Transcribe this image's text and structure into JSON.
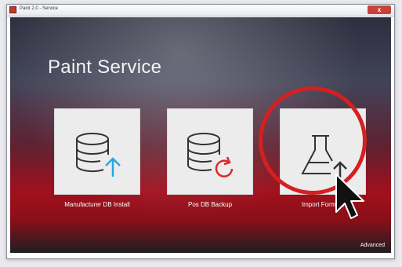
{
  "window": {
    "title": "Paint 2.0 - Service",
    "close_label": "x"
  },
  "main": {
    "page_title": "Paint Service",
    "tiles": [
      {
        "label": "Manufacturer DB Install",
        "icon": "database-upload-icon",
        "accent": "#29a8df"
      },
      {
        "label": "Pos DB Backup",
        "icon": "database-refresh-icon",
        "accent": "#d92a2a"
      },
      {
        "label": "Import Formula",
        "icon": "flask-upload-icon",
        "accent": "#333333"
      }
    ]
  },
  "footer": {
    "advanced_label": "Advanced"
  },
  "colors": {
    "highlight_circle": "#d42020"
  }
}
